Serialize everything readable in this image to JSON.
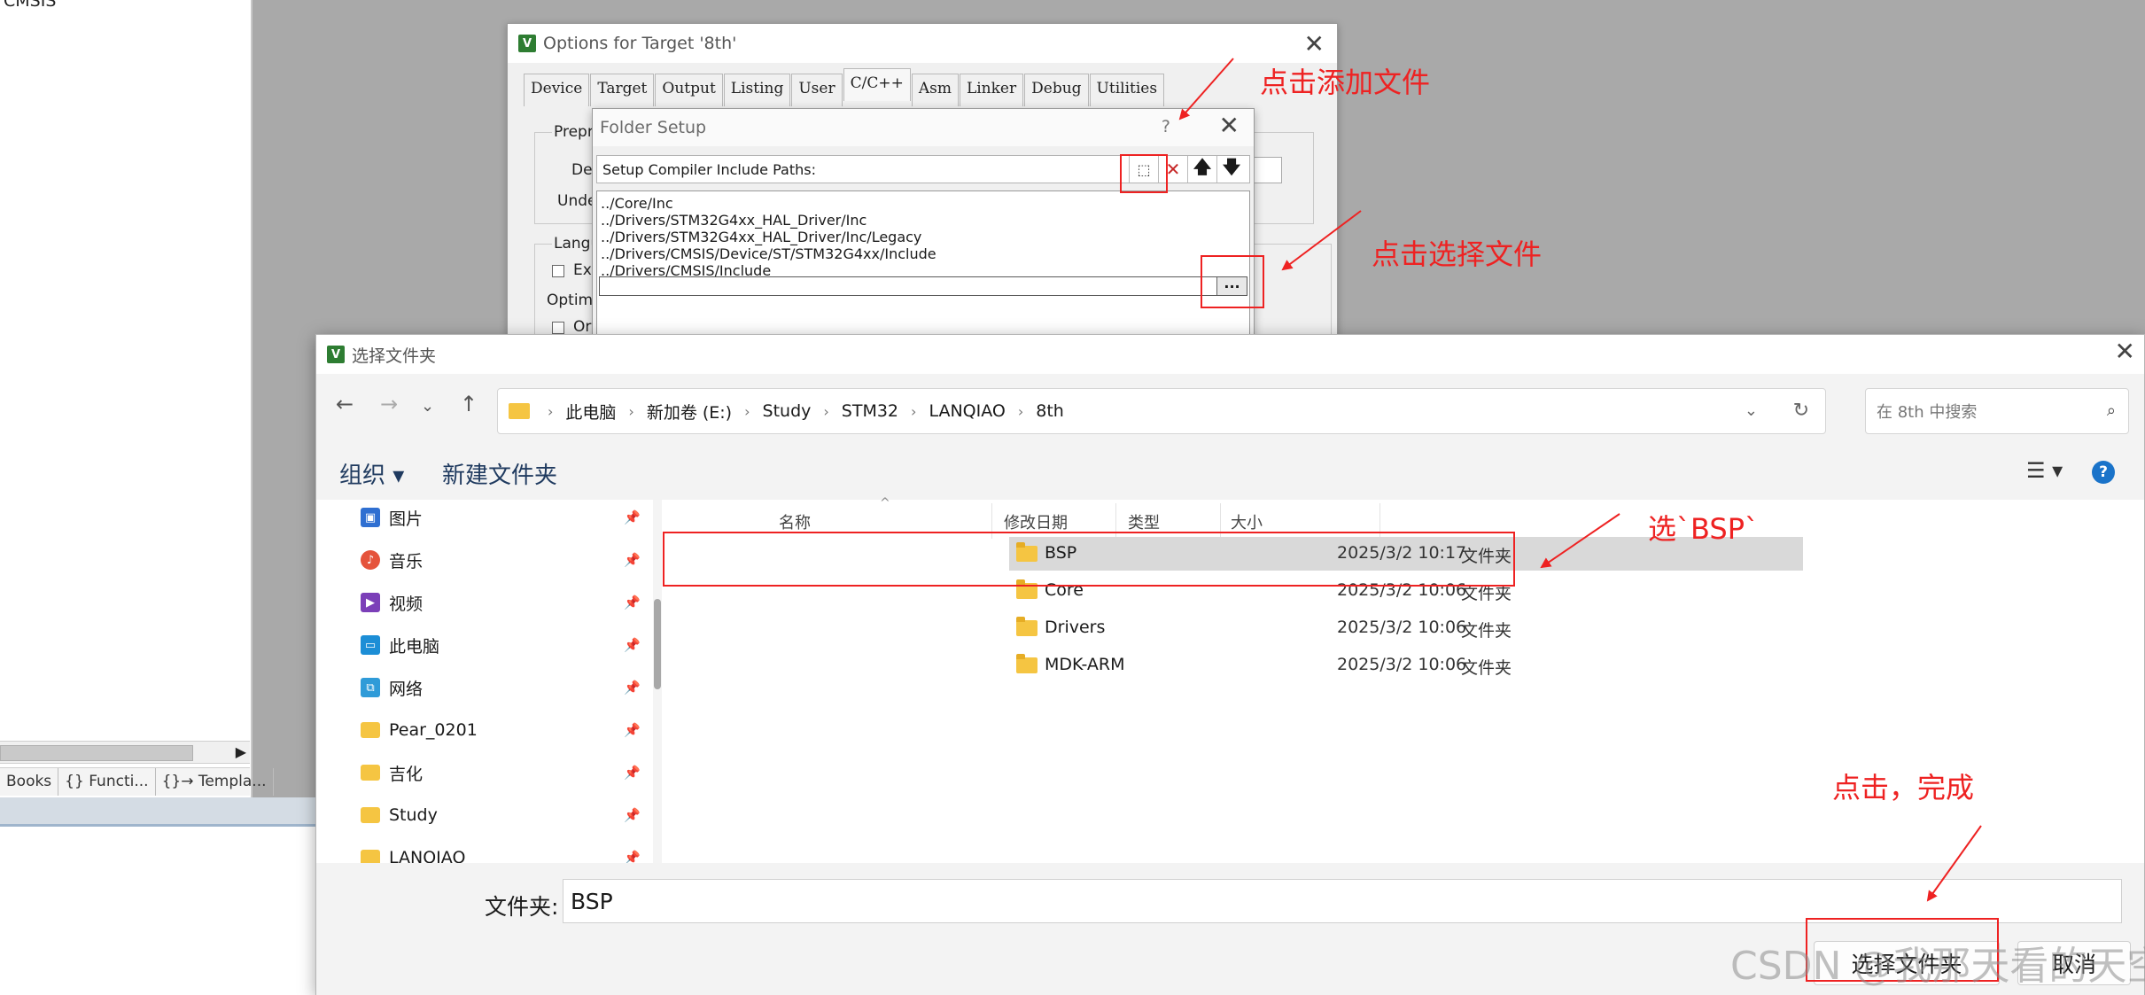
{
  "ide": {
    "tree_text": "CMSIS",
    "project_tabs": [
      "Books",
      "{} Functi...",
      "{}→ Templa..."
    ]
  },
  "options_window": {
    "title": "Options for Target '8th'",
    "tabs": [
      "Device",
      "Target",
      "Output",
      "Listing",
      "User",
      "C/C++",
      "Asm",
      "Linker",
      "Debug",
      "Utilities"
    ],
    "active_tab": "C/C++",
    "labels": {
      "preprocessor": "Prepro",
      "define": "De",
      "undefine": "Unde",
      "language": "Langu",
      "execute": "Ex",
      "optimization": "Optimiz",
      "option": "Or"
    }
  },
  "folder_setup": {
    "title": "Folder Setup",
    "help": "?",
    "header": "Setup Compiler Include Paths:",
    "paths": [
      "../Core/Inc",
      "../Drivers/STM32G4xx_HAL_Driver/Inc",
      "../Drivers/STM32G4xx_HAL_Driver/Inc/Legacy",
      "../Drivers/CMSIS/Device/ST/STM32G4xx/Include",
      "../Drivers/CMSIS/Include"
    ],
    "browse_label": "..."
  },
  "picker": {
    "title": "选择文件夹",
    "breadcrumb": [
      "此电脑",
      "新加卷 (E:)",
      "Study",
      "STM32",
      "LANQIAO",
      "8th"
    ],
    "search_placeholder": "在 8th 中搜索",
    "organize": "组织 ▾",
    "new_folder": "新建文件夹",
    "nav_items": [
      {
        "label": "图片",
        "icon": "pictures-icon",
        "color": "#2f6fd1"
      },
      {
        "label": "音乐",
        "icon": "music-icon",
        "color": "#e5533b"
      },
      {
        "label": "视频",
        "icon": "videos-icon",
        "color": "#7b3fb8"
      },
      {
        "label": "此电脑",
        "icon": "this-pc-icon",
        "color": "#1c8ed6"
      },
      {
        "label": "网络",
        "icon": "network-icon",
        "color": "#2f9bd8"
      },
      {
        "label": "Pear_0201",
        "icon": "folder-icon",
        "color": "#f5c542"
      },
      {
        "label": "吉化",
        "icon": "folder-icon",
        "color": "#f5c542"
      },
      {
        "label": "Study",
        "icon": "folder-icon",
        "color": "#f5c542"
      },
      {
        "label": "LANQIAO",
        "icon": "folder-icon",
        "color": "#f5c542"
      }
    ],
    "columns": {
      "name": "名称",
      "date": "修改日期",
      "type": "类型",
      "size": "大小"
    },
    "rows": [
      {
        "name": "BSP",
        "date": "2025/3/2 10:17",
        "type": "文件夹"
      },
      {
        "name": "Core",
        "date": "2025/3/2 10:06",
        "type": "文件夹"
      },
      {
        "name": "Drivers",
        "date": "2025/3/2 10:06",
        "type": "文件夹"
      },
      {
        "name": "MDK-ARM",
        "date": "2025/3/2 10:06",
        "type": "文件夹"
      }
    ],
    "folder_label": "文件夹:",
    "folder_value": "BSP",
    "select_button": "选择文件夹",
    "cancel_button": "取消"
  },
  "annotations": {
    "add_file": "点击添加文件",
    "choose_file": "点击选择文件",
    "select_bsp": "选`BSP`",
    "click_done": "点击，完成",
    "color": "#ee2222"
  },
  "watermark": "CSDN @我那天看的天空"
}
